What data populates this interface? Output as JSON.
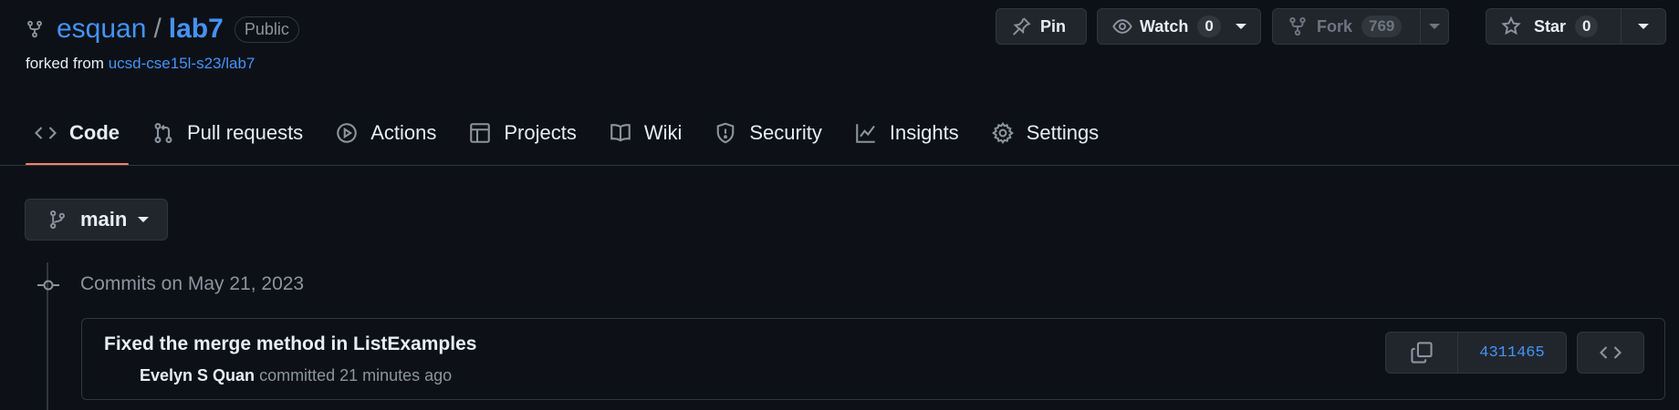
{
  "repo": {
    "owner": "esquan",
    "separator": "/",
    "name": "lab7",
    "visibility": "Public",
    "forked_prefix": "forked from",
    "forked_source": "ucsd-cse15l-s23/lab7"
  },
  "actions": {
    "pin_label": "Pin",
    "watch_label": "Watch",
    "watch_count": "0",
    "fork_label": "Fork",
    "fork_count": "769",
    "star_label": "Star",
    "star_count": "0"
  },
  "tabs": [
    {
      "label": "Code",
      "icon": "code-icon",
      "active": true
    },
    {
      "label": "Pull requests",
      "icon": "pull-request-icon"
    },
    {
      "label": "Actions",
      "icon": "play-icon"
    },
    {
      "label": "Projects",
      "icon": "table-icon"
    },
    {
      "label": "Wiki",
      "icon": "book-icon"
    },
    {
      "label": "Security",
      "icon": "shield-icon"
    },
    {
      "label": "Insights",
      "icon": "graph-icon"
    },
    {
      "label": "Settings",
      "icon": "gear-icon"
    }
  ],
  "branch": {
    "name": "main"
  },
  "commits": {
    "group_title": "Commits on May 21, 2023",
    "items": [
      {
        "message": "Fixed the merge method in ListExamples",
        "author": "Evelyn S Quan",
        "action": "committed",
        "time": "21 minutes ago",
        "sha": "4311465"
      }
    ]
  },
  "colors": {
    "background": "#0d1117",
    "link": "#4493f8",
    "active_tab_underline": "#f78166",
    "border": "#30363d"
  }
}
